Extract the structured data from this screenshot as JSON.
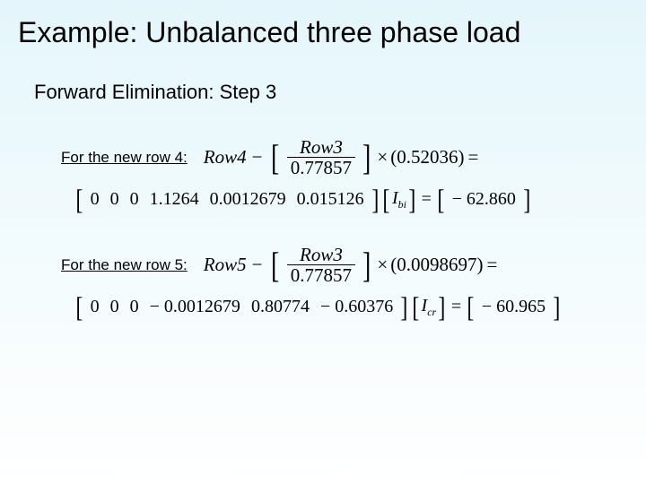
{
  "title": "Example: Unbalanced three phase load",
  "subtitle": "Forward Elimination: Step 3",
  "row4": {
    "label": "For the new row 4:",
    "lhs_row": "Row4",
    "frac_num": "Row3",
    "frac_den": "0.77857",
    "mult": "0.52036",
    "vec": [
      "0",
      "0",
      "0",
      "1.1264",
      "0.0012679",
      "0.015126"
    ],
    "var": "I",
    "var_sub": "bi",
    "rhs": "− 62.860"
  },
  "row5": {
    "label": "For the new row 5:",
    "lhs_row": "Row5",
    "frac_num": "Row3",
    "frac_den": "0.77857",
    "mult": "0.0098697",
    "vec": [
      "0",
      "0",
      "0",
      "− 0.0012679",
      "0.80774",
      "− 0.60376"
    ],
    "var": "I",
    "var_sub": "cr",
    "rhs": "− 60.965"
  }
}
